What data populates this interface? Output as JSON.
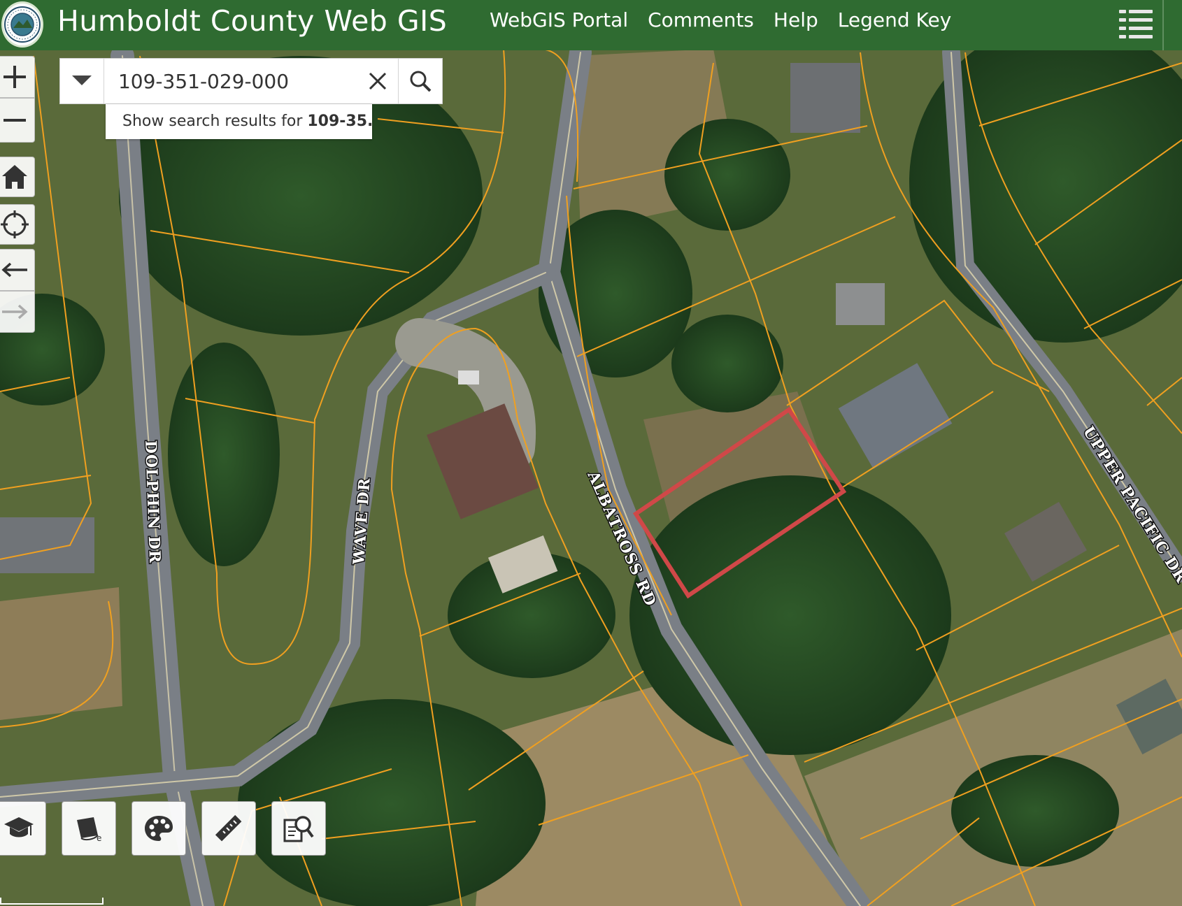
{
  "header": {
    "title": "Humboldt County Web GIS",
    "nav": [
      "WebGIS Portal",
      "Comments",
      "Help",
      "Legend Key"
    ],
    "seal_text": "COUNTY OF HUMBOLDT"
  },
  "search": {
    "value": "109-351-029-000",
    "suggestion_prefix": "Show search results for ",
    "suggestion_bold": "109-35..."
  },
  "map": {
    "road_labels": [
      "DOLPHIN DR",
      "WAVE DR",
      "ALBATROSS RD",
      "UPPER PACIFIC DR"
    ],
    "colors": {
      "header": "#2f6b31",
      "parcel_line": "#f0a020",
      "selected_parcel": "#d04848",
      "road": "#7a7f86"
    }
  },
  "left_tools": [
    "zoom-in",
    "zoom-out",
    "home",
    "locate",
    "back",
    "forward"
  ],
  "bottom_tools": [
    "training",
    "learn",
    "basemap",
    "measure",
    "query"
  ]
}
